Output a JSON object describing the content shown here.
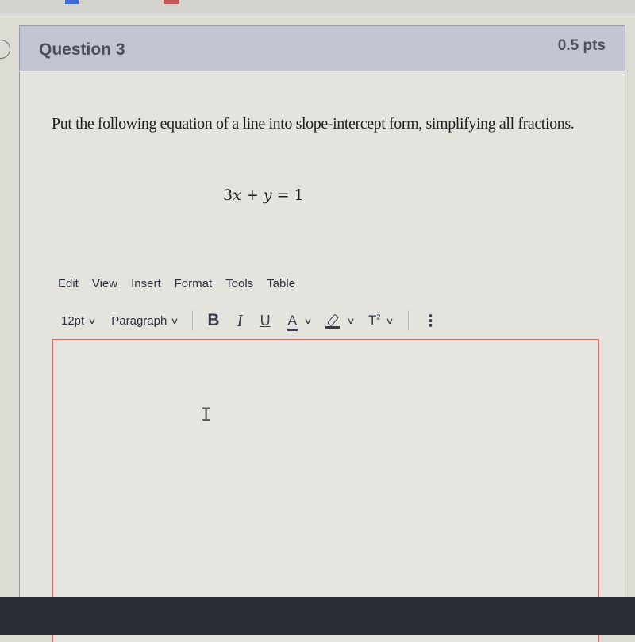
{
  "question": {
    "title": "Question 3",
    "points": "0.5 pts",
    "prompt": "Put the following equation of a line into slope-intercept form, simplifying all fractions.",
    "equation": {
      "coef": "3",
      "var1": "x",
      "op": " + ",
      "var2": "y",
      "eq": " = ",
      "rhs": "1"
    }
  },
  "editor": {
    "menu": [
      "Edit",
      "View",
      "Insert",
      "Format",
      "Tools",
      "Table"
    ],
    "font_size": "12pt",
    "block_format": "Paragraph",
    "bold": "B",
    "italic": "I",
    "underline": "U",
    "text_color": "A",
    "superscript": "T",
    "superscript_mark": "2",
    "more": "⋮",
    "chevron": "v",
    "cursor_glyph": "I",
    "content": "",
    "border_color": "#d46a66"
  }
}
